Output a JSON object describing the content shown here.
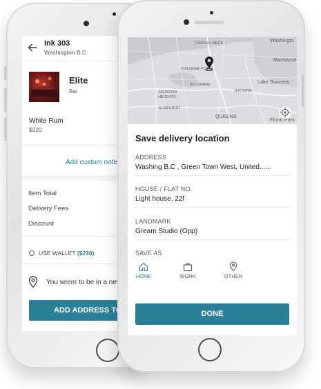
{
  "back_screen": {
    "header": {
      "title": "Ink 303",
      "subtitle": "Washington B.C"
    },
    "restaurant": {
      "name": "Elite",
      "category": "Bar"
    },
    "item": {
      "name": "White Rum",
      "price": "$220"
    },
    "add_note_label": "Add custom note",
    "summary": [
      "Item Total",
      "Delivery Fees",
      "Discount"
    ],
    "wallet": {
      "label": "USE WALLET",
      "amount": "($230)"
    },
    "location_notice": "You seem to be in a new",
    "add_address_button": "ADD ADDRESS TO"
  },
  "front_screen": {
    "map": {
      "labels": [
        "THROGS NECK",
        "Washingto",
        "Manhasse",
        "COLLEGE POINT",
        "FLUSHING",
        "Lake Success",
        "JACKSON HEIGHTS",
        "BAYSIDE",
        "ELMHURST",
        "QUEENS",
        "Floral Park"
      ]
    },
    "title": "Save delivery location",
    "fields": [
      {
        "label": "ADDRESS",
        "value": "Washing B.C , Green Town West, United......"
      },
      {
        "label": "HOUSE / FLAT NO.",
        "value": "Light house, 22f"
      },
      {
        "label": "LANDMARK",
        "value": "Gream Studio (Opp)"
      }
    ],
    "save_as": {
      "label": "SAVE AS",
      "options": [
        {
          "label": "HOME",
          "icon": "home-icon",
          "selected": true
        },
        {
          "label": "WORK",
          "icon": "briefcase-icon",
          "selected": false
        },
        {
          "label": "OTHER",
          "icon": "location-pin-icon",
          "selected": false
        }
      ]
    },
    "done_button": "DONE"
  },
  "colors": {
    "accent": "#2a8099",
    "link": "#2a8099"
  }
}
